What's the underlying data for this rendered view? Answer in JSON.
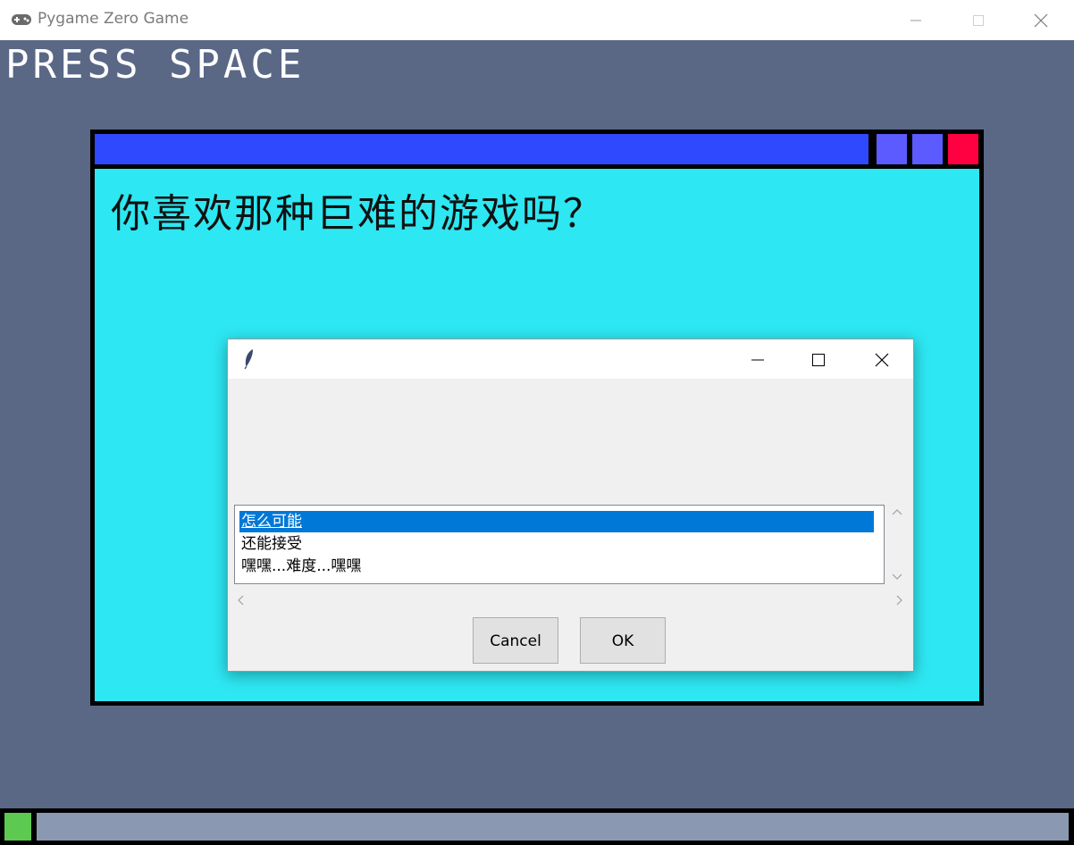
{
  "window": {
    "title": "Pygame Zero Game"
  },
  "game": {
    "hint": "PRESS SPACE",
    "question": "你喜欢那种巨难的游戏吗？",
    "colors": {
      "background": "#5a6886",
      "panel_body": "#2de7f2",
      "panel_bar": "#2f49ff",
      "panel_button": "#5b5bff",
      "panel_close": "#ff0040",
      "progress_fill": "#5ec950",
      "progress_track": "#8a98b2"
    }
  },
  "dialog": {
    "icon": "feather-icon",
    "options": [
      {
        "label": "怎么可能",
        "selected": true
      },
      {
        "label": "还能接受",
        "selected": false
      },
      {
        "label": "嘿嘿...难度...嘿嘿",
        "selected": false
      }
    ],
    "cancel_label": "Cancel",
    "ok_label": "OK"
  }
}
